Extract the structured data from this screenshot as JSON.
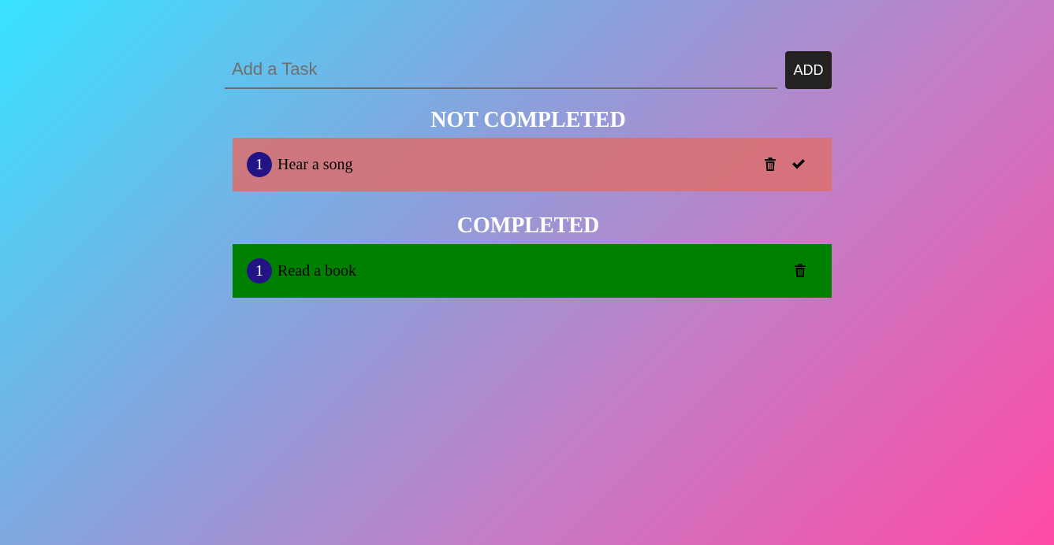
{
  "input": {
    "placeholder": "Add a Task",
    "value": ""
  },
  "add_button": {
    "label": "ADD"
  },
  "sections": {
    "not_completed": {
      "title": "NOT COMPLETED",
      "items": [
        {
          "number": "1",
          "text": "Hear a song"
        }
      ]
    },
    "completed": {
      "title": "COMPLETED",
      "items": [
        {
          "number": "1",
          "text": "Read a book"
        }
      ]
    }
  },
  "icons": {
    "delete": "trash-icon",
    "complete": "check-icon"
  },
  "colors": {
    "add_button_bg": "#242121",
    "not_completed_item_bg": "#d97878",
    "completed_item_bg": "#008000",
    "number_badge_bg": "#231485",
    "section_title": "#ffffff"
  }
}
